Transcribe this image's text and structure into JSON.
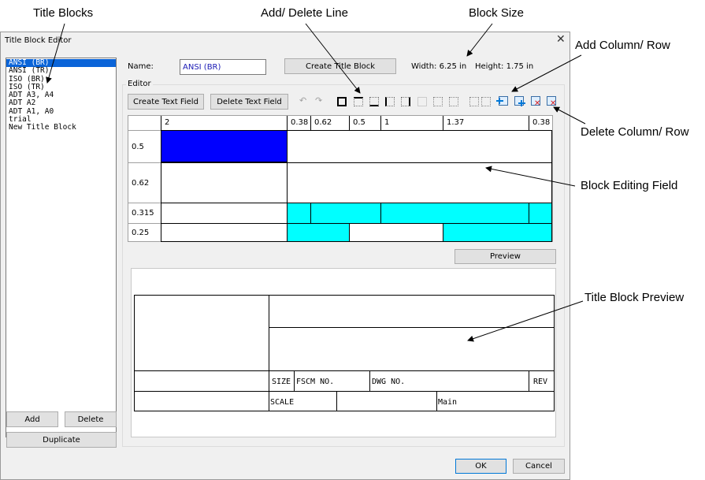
{
  "annotations": {
    "title_blocks": "Title Blocks",
    "add_delete_line": "Add/ Delete Line",
    "block_size": "Block Size",
    "add_column_row": "Add Column/ Row",
    "delete_column_row": "Delete Column/ Row",
    "block_editing_field": "Block Editing Field",
    "title_block_preview": "Title Block Preview"
  },
  "dialog": {
    "title": "Title Block Editor",
    "close": "✕"
  },
  "title_list": {
    "items": [
      "ANSI (BR)",
      "ANSI (TR)",
      "ISO (BR)",
      "ISO (TR)",
      "ADT A3, A4",
      "ADT A2",
      "ADT A1, A0",
      "trial",
      "New Title Block"
    ],
    "selected_index": 0
  },
  "left_buttons": {
    "add": "Add",
    "delete": "Delete",
    "duplicate": "Duplicate"
  },
  "name_field": {
    "label": "Name:",
    "value": "ANSI (BR)"
  },
  "create_title_block": "Create Title Block",
  "size": {
    "width": "Width: 6.25 in",
    "height": "Height: 1.75 in"
  },
  "editor": {
    "label": "Editor",
    "create_text_field": "Create Text Field",
    "delete_text_field": "Delete Text Field"
  },
  "toolbar": {
    "icons": [
      "undo-icon",
      "redo-icon",
      "border-all-icon",
      "border-top-icon",
      "border-bottom-icon",
      "border-left-icon",
      "border-right-icon",
      "border-none-icon",
      "border-dotted-h-icon",
      "border-dotted-v-icon",
      "border-dotted-all-icon",
      "add-column-icon",
      "add-row-icon",
      "delete-column-icon",
      "delete-row-icon"
    ],
    "colors": {
      "add": "#0078d7",
      "delete": "#d81e1e"
    }
  },
  "grid": {
    "column_headers": [
      "2",
      "0.38",
      "0.62",
      "0.5",
      "1",
      "1.37",
      "0.38"
    ],
    "row_headers": [
      "0.5",
      "0.62",
      "0.315",
      "0.25"
    ],
    "selected_color": "#0000ff",
    "highlight_color": "#00ffff"
  },
  "preview_button": "Preview",
  "preview_labels": {
    "size": "SIZE",
    "fscm": "FSCM NO.",
    "dwg": "DWG NO.",
    "rev": "REV",
    "scale": "SCALE",
    "main": "Main"
  },
  "footer": {
    "ok": "OK",
    "cancel": "Cancel"
  }
}
